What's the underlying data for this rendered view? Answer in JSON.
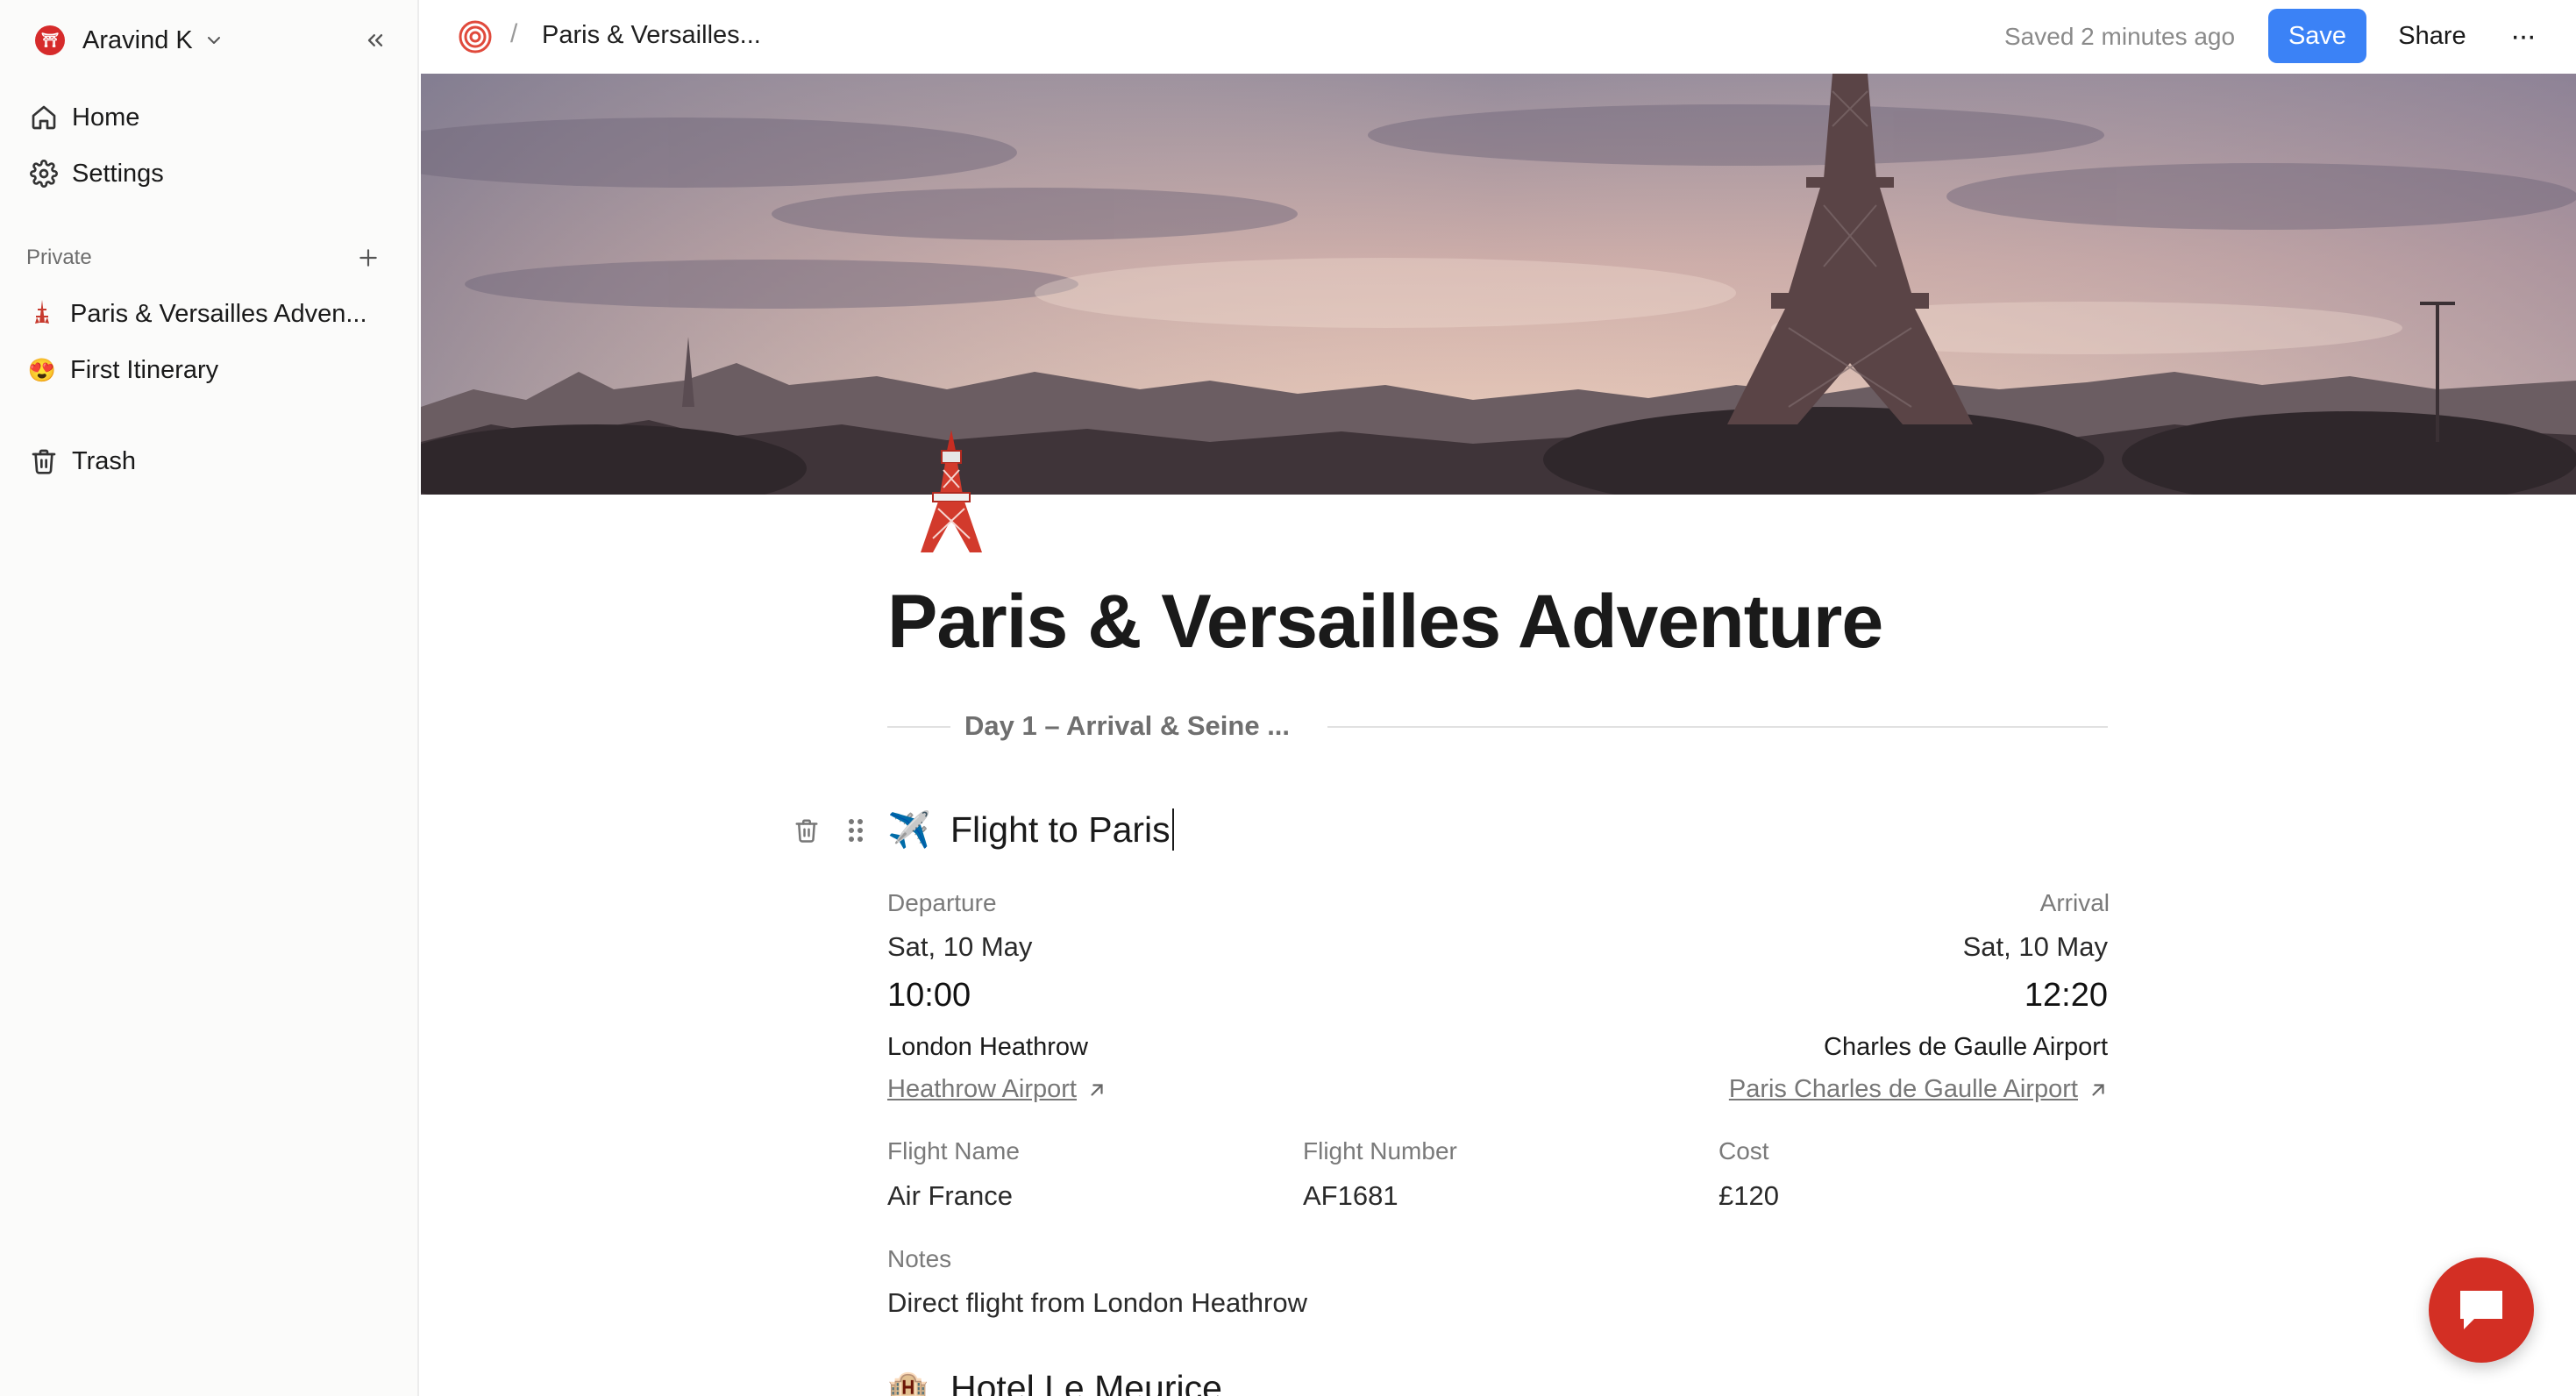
{
  "sidebar": {
    "workspace": {
      "name": "Aravind K",
      "avatar_color": "#d62b2b"
    },
    "nav": [
      {
        "label": "Home",
        "icon": "home-icon"
      },
      {
        "label": "Settings",
        "icon": "gear-icon"
      }
    ],
    "section_label": "Private",
    "pages": [
      {
        "label": "Paris & Versailles Adven...",
        "icon": "tower-emoji"
      },
      {
        "label": "First Itinerary",
        "icon": "heart-eyes-emoji"
      }
    ],
    "trash_label": "Trash"
  },
  "topbar": {
    "breadcrumb_sep": "/",
    "breadcrumb_title": "Paris & Versailles...",
    "saved_status": "Saved 2 minutes ago",
    "save_label": "Save",
    "share_label": "Share",
    "more_label": "···",
    "accent_color": "#3b82f6"
  },
  "page": {
    "title": "Paris & Versailles Adventure",
    "day_divider": "Day 1 – Arrival & Seine ..."
  },
  "flight_block": {
    "emoji": "✈️",
    "heading": "Flight to Paris",
    "departure": {
      "label": "Departure",
      "date": "Sat, 10 May",
      "time": "10:00",
      "place": "London Heathrow",
      "link": "Heathrow Airport"
    },
    "arrival": {
      "label": "Arrival",
      "date": "Sat, 10 May",
      "time": "12:20",
      "place": "Charles de Gaulle Airport",
      "link": "Paris Charles de Gaulle Airport"
    },
    "flight_name": {
      "label": "Flight Name",
      "value": "Air France"
    },
    "flight_number": {
      "label": "Flight Number",
      "value": "AF1681"
    },
    "cost": {
      "label": "Cost",
      "value": "£120"
    },
    "notes": {
      "label": "Notes",
      "value": "Direct flight from London Heathrow"
    }
  },
  "next_block": {
    "emoji": "🏨",
    "heading": "Hotel Le Meurice"
  },
  "chat_fab_color": "#d32f24"
}
